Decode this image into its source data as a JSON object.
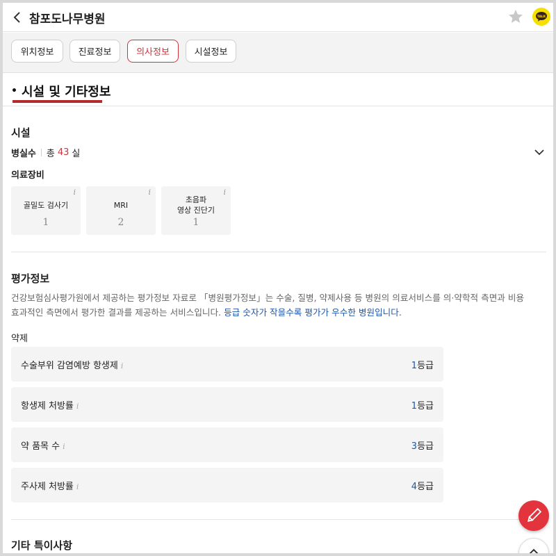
{
  "header": {
    "title": "참포도나무병원",
    "kakao_label": "TALK"
  },
  "tabs": [
    {
      "label": "위치정보",
      "active": false
    },
    {
      "label": "진료정보",
      "active": false
    },
    {
      "label": "의사정보",
      "active": true
    },
    {
      "label": "시설정보",
      "active": false
    }
  ],
  "section": {
    "title": "시설 및 기타정보"
  },
  "facility": {
    "heading": "시설",
    "rooms_label": "병실수",
    "rooms_prefix": "총",
    "rooms_count": "43",
    "rooms_suffix": "실",
    "equipment_heading": "의료장비",
    "equipment": [
      {
        "name_line1": "골밀도 검사기",
        "name_line2": "",
        "count": "1"
      },
      {
        "name_line1": "MRI",
        "name_line2": "",
        "count": "2"
      },
      {
        "name_line1": "초음파",
        "name_line2": "영상 진단기",
        "count": "1"
      }
    ],
    "info_glyph": "i"
  },
  "evaluation": {
    "heading": "평가정보",
    "description_line1": "건강보험심사평가원에서 제공하는 평가정보 자료로 「병원평가정보」는 수술, 질병, 약제사용 등 병원의 의료서비스를 의·약학적 측면과 비용",
    "description_line2": "효과적인 측면에서 평가한 결과를 제공하는 서비스입니다. ",
    "description_highlight": "등급 숫자가 작을수록 평가가 우수한 병원입니다.",
    "subheading": "약제",
    "grade_suffix": "등급",
    "items": [
      {
        "label": "수술부위 감염예방 항생제",
        "grade": "1"
      },
      {
        "label": "항생제 처방률",
        "grade": "1"
      },
      {
        "label": "약 품목 수",
        "grade": "3"
      },
      {
        "label": "주사제 처방률",
        "grade": "4"
      }
    ]
  },
  "other": {
    "heading": "기타 특이사항"
  },
  "colors": {
    "accent": "#d0333c",
    "underline": "#b52a2a",
    "link_blue": "#1f57a8",
    "kakao_yellow": "#f6e000"
  }
}
